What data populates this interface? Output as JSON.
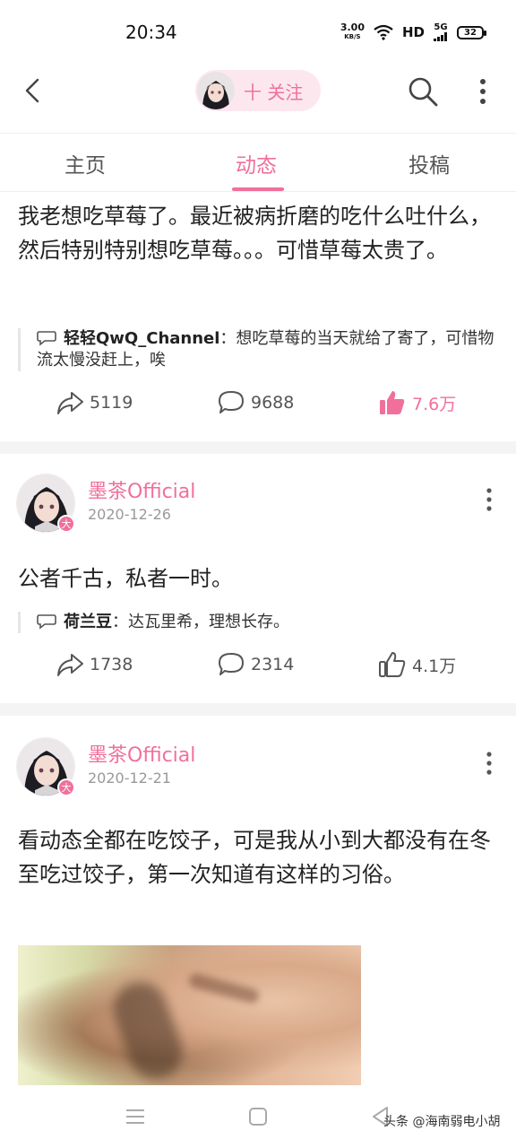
{
  "status_bar": {
    "time": "20:34",
    "net_speed_value": "3.00",
    "net_speed_unit": "KB/S",
    "network_type": "HD",
    "signal_label": "5G",
    "battery": "32"
  },
  "header": {
    "follow_label": "十 关注"
  },
  "tabs": [
    {
      "label": "主页"
    },
    {
      "label": "动态"
    },
    {
      "label": "投稿"
    }
  ],
  "active_tab": "动态",
  "posts": [
    {
      "text": "我老想吃草莓了。最近被病折磨的吃什么吐什么，然后特别特别想吃草莓。。。可惜草莓太贵了。",
      "comment_author": "轻轻QwQ_Channel",
      "comment_text": "：想吃草莓的当天就给了寄了，可惜物流太慢没赶上，唉",
      "shares": "5119",
      "comments": "9688",
      "likes": "7.6万"
    },
    {
      "author": "墨茶Official",
      "date": "2020-12-26",
      "text": "公者千古，私者一时。",
      "comment_author": "荷兰豆",
      "comment_text": "：达瓦里希，理想长存。",
      "shares": "1738",
      "comments": "2314",
      "likes": "4.1万"
    },
    {
      "author": "墨茶Official",
      "date": "2020-12-21",
      "text": "看动态全都在吃饺子，可是我从小到大都没有在冬至吃过饺子，第一次知道有这样的习俗。"
    }
  ],
  "vip_badge": "大",
  "watermark": "头条 @海南弱电小胡",
  "colors": {
    "accent": "#f0709b",
    "pill_bg": "#fde7ee"
  }
}
